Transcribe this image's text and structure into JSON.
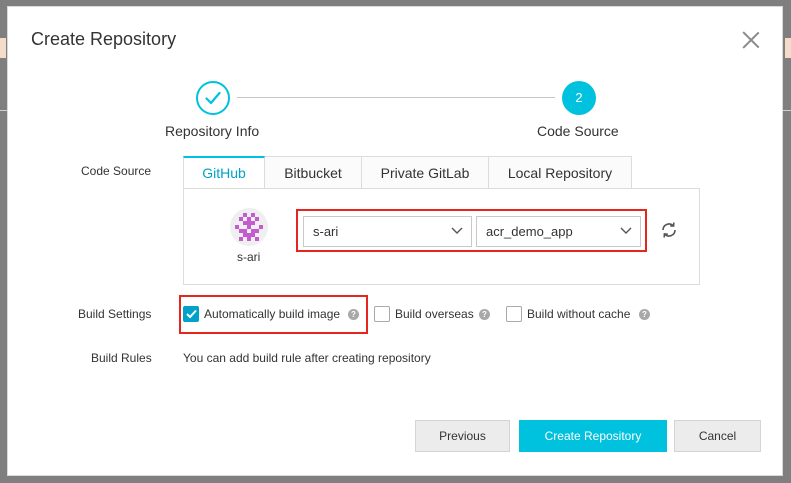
{
  "dialog": {
    "title": "Create Repository"
  },
  "steps": [
    {
      "label": "Repository Info",
      "status": "done"
    },
    {
      "label": "Code Source",
      "number": "2",
      "status": "active"
    }
  ],
  "code_source": {
    "label": "Code Source",
    "tabs": [
      "GitHub",
      "Bitbucket",
      "Private GitLab",
      "Local Repository"
    ],
    "active_tab": "GitHub",
    "avatar_name": "s-ari",
    "namespace_select": "s-ari",
    "repository_select": "acr_demo_app"
  },
  "build_settings": {
    "label": "Build Settings",
    "auto_build": {
      "label": "Automatically build image",
      "checked": true
    },
    "overseas": {
      "label": "Build overseas",
      "checked": false
    },
    "no_cache": {
      "label": "Build without cache",
      "checked": false
    },
    "help_glyph": "?"
  },
  "build_rules": {
    "label": "Build Rules",
    "text": "You can add build rule after creating repository"
  },
  "footer": {
    "previous": "Previous",
    "create": "Create Repository",
    "cancel": "Cancel"
  },
  "colors": {
    "accent": "#00c1de",
    "highlight_box": "#e5261f"
  }
}
